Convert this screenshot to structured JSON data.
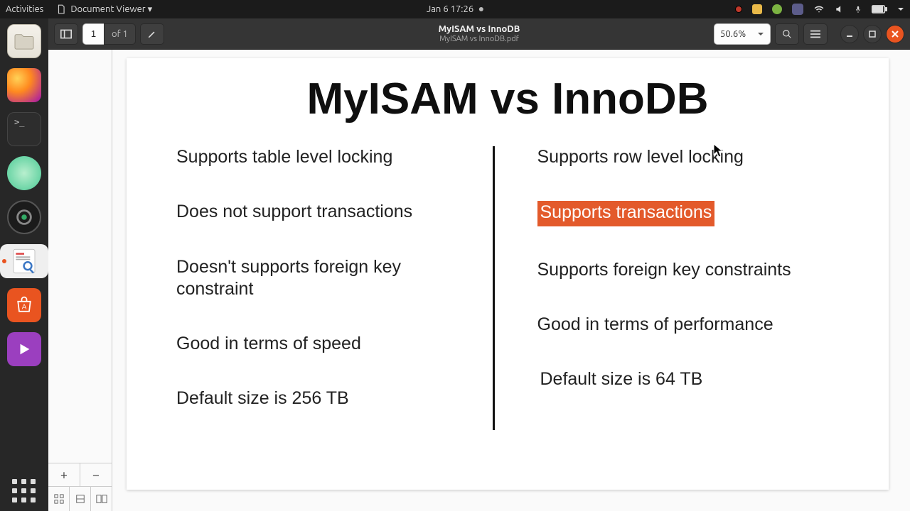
{
  "topbar": {
    "activities": "Activities",
    "app_menu": "Document Viewer ▾",
    "clock": "Jan 6  17:26"
  },
  "dock": {
    "items": [
      "files",
      "firefox",
      "terminal",
      "atom",
      "obs",
      "evince",
      "software",
      "media"
    ]
  },
  "headerbar": {
    "page_current": "1",
    "page_of": "of 1",
    "title": "MyISAM vs InnoDB",
    "subtitle": "MyISAM vs InnoDB.pdf",
    "zoom": "50.6%"
  },
  "document": {
    "title": "MyISAM vs InnoDB",
    "left_col": [
      "Supports table level locking",
      "Does not support transactions",
      "Doesn't supports foreign key constraint",
      "Good in terms of speed",
      "Default size is 256 TB"
    ],
    "right_col": [
      "Supports row level locking",
      "Supports transactions",
      "Supports foreign key constraints",
      "Good in terms of performance",
      "Default size is 64 TB"
    ],
    "highlighted_right_index": 1
  },
  "thumb": {
    "plus": "+",
    "minus": "−"
  }
}
